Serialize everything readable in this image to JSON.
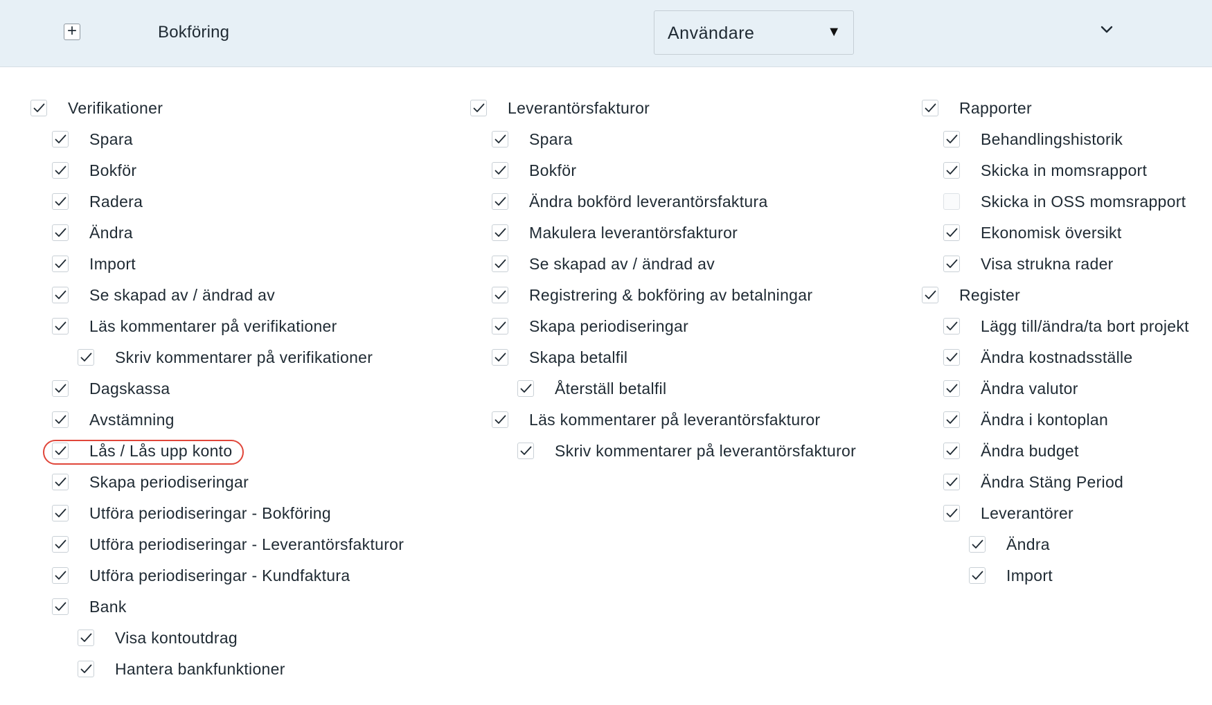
{
  "header": {
    "expand_symbol": "+",
    "section_title": "Bokföring",
    "role_select": {
      "selected": "Användare",
      "arrow": "▼"
    },
    "collapse_icon": "chevron-down-icon"
  },
  "columns": [
    {
      "items": [
        {
          "label": "Verifikationer",
          "checked": true,
          "level": 0
        },
        {
          "label": "Spara",
          "checked": true,
          "level": 1
        },
        {
          "label": "Bokför",
          "checked": true,
          "level": 1
        },
        {
          "label": "Radera",
          "checked": true,
          "level": 1
        },
        {
          "label": "Ändra",
          "checked": true,
          "level": 1
        },
        {
          "label": "Import",
          "checked": true,
          "level": 1
        },
        {
          "label": "Se skapad av / ändrad av",
          "checked": true,
          "level": 1
        },
        {
          "label": "Läs kommentarer på verifikationer",
          "checked": true,
          "level": 1
        },
        {
          "label": "Skriv kommentarer på verifikationer",
          "checked": true,
          "level": 2
        },
        {
          "label": "Dagskassa",
          "checked": true,
          "level": 1
        },
        {
          "label": "Avstämning",
          "checked": true,
          "level": 1
        },
        {
          "label": "Lås / Lås upp konto",
          "checked": true,
          "level": 1
        },
        {
          "label": "Skapa periodiseringar",
          "checked": true,
          "level": 1
        },
        {
          "label": "Utföra periodiseringar - Bokföring",
          "checked": true,
          "level": 1
        },
        {
          "label": "Utföra periodiseringar - Leverantörsfakturor",
          "checked": true,
          "level": 1
        },
        {
          "label": "Utföra periodiseringar - Kundfaktura",
          "checked": true,
          "level": 1
        },
        {
          "label": "Bank",
          "checked": true,
          "level": 1
        },
        {
          "label": "Visa kontoutdrag",
          "checked": true,
          "level": 2
        },
        {
          "label": "Hantera bankfunktioner",
          "checked": true,
          "level": 2
        }
      ]
    },
    {
      "items": [
        {
          "label": "Leverantörsfakturor",
          "checked": true,
          "level": 0
        },
        {
          "label": "Spara",
          "checked": true,
          "level": 1
        },
        {
          "label": "Bokför",
          "checked": true,
          "level": 1
        },
        {
          "label": "Ändra bokförd leverantörsfaktura",
          "checked": true,
          "level": 1
        },
        {
          "label": "Makulera leverantörsfakturor",
          "checked": true,
          "level": 1
        },
        {
          "label": "Se skapad av / ändrad av",
          "checked": true,
          "level": 1
        },
        {
          "label": "Registrering & bokföring av betalningar",
          "checked": true,
          "level": 1
        },
        {
          "label": "Skapa periodiseringar",
          "checked": true,
          "level": 1
        },
        {
          "label": "Skapa betalfil",
          "checked": true,
          "level": 1
        },
        {
          "label": "Återställ betalfil",
          "checked": true,
          "level": 2
        },
        {
          "label": "Läs kommentarer på leverantörsfakturor",
          "checked": true,
          "level": 1
        },
        {
          "label": "Skriv kommentarer på leverantörsfakturor",
          "checked": true,
          "level": 2
        }
      ]
    },
    {
      "items": [
        {
          "label": "Rapporter",
          "checked": true,
          "level": 0
        },
        {
          "label": "Behandlingshistorik",
          "checked": true,
          "level": 1
        },
        {
          "label": "Skicka in momsrapport",
          "checked": true,
          "level": 1
        },
        {
          "label": "Skicka in OSS momsrapport",
          "checked": false,
          "level": 1
        },
        {
          "label": "Ekonomisk översikt",
          "checked": true,
          "level": 1
        },
        {
          "label": "Visa strukna rader",
          "checked": true,
          "level": 1
        },
        {
          "label": "Register",
          "checked": true,
          "level": 0
        },
        {
          "label": "Lägg till/ändra/ta bort projekt",
          "checked": true,
          "level": 1
        },
        {
          "label": "Ändra kostnadsställe",
          "checked": true,
          "level": 1
        },
        {
          "label": "Ändra valutor",
          "checked": true,
          "level": 1
        },
        {
          "label": "Ändra i kontoplan",
          "checked": true,
          "level": 1
        },
        {
          "label": "Ändra budget",
          "checked": true,
          "level": 1
        },
        {
          "label": "Ändra Stäng Period",
          "checked": true,
          "level": 1
        },
        {
          "label": "Leverantörer",
          "checked": true,
          "level": 1
        },
        {
          "label": "Ändra",
          "checked": true,
          "level": 2
        },
        {
          "label": "Import",
          "checked": true,
          "level": 2
        }
      ]
    }
  ],
  "annotation": {
    "highlighted_item": "Lås / Lås upp konto",
    "ring_color": "#e0463a"
  }
}
